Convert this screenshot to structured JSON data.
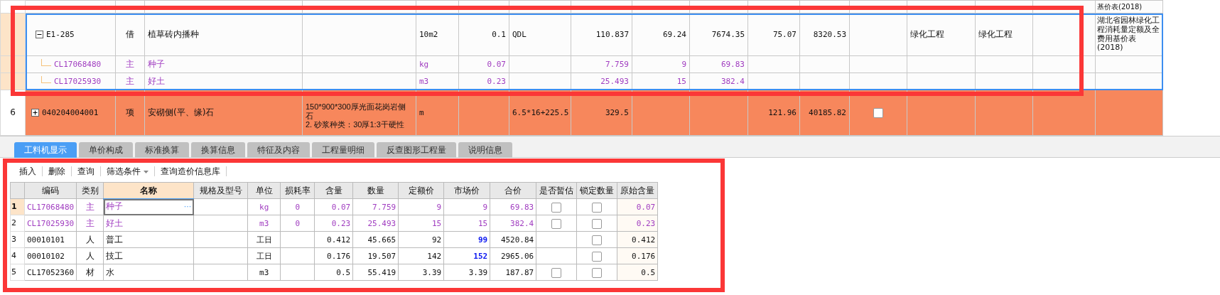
{
  "top_grid": {
    "rows": [
      {
        "kind": "partial",
        "selected": false,
        "highlighted": false,
        "column_17": "基价表(2018)"
      },
      {
        "kind": "quota",
        "selected": true,
        "highlighted": false,
        "expanded": true,
        "column_1": "E1-285",
        "column_2": "借",
        "column_3": "植草砖内播种",
        "column_5": "10m2",
        "column_6": "0.1",
        "column_7": "QDL",
        "column_8": "110.837",
        "column_9": "69.24",
        "column_10": "7674.35",
        "column_11": "75.07",
        "column_12": "8320.53",
        "column_14": "绿化工程",
        "column_15": "绿化工程",
        "column_17": "湖北省园林绿化工程消耗量定额及全费用基价表(2018)"
      },
      {
        "kind": "material",
        "selected": true,
        "highlighted": false,
        "column_1": "CL17068480",
        "column_2": "主",
        "column_3": "种子",
        "column_5": "kg",
        "column_6": "0.07",
        "column_8": "7.759",
        "column_9": "9",
        "column_10": "69.83"
      },
      {
        "kind": "material",
        "selected": true,
        "highlighted": false,
        "column_1": "CL17025930",
        "column_2": "主",
        "column_3": "好土",
        "column_5": "m3",
        "column_6": "0.23",
        "column_8": "25.493",
        "column_9": "15",
        "column_10": "382.4"
      },
      {
        "kind": "item",
        "selected": false,
        "highlighted": true,
        "expanded": false,
        "row_number": "6",
        "column_1": "040204004001",
        "column_2": "项",
        "column_3": "安砌侧(平、缘)石",
        "column_4": [
          "150*900*300厚光面花岗岩侧石",
          "2. 砂浆种类：30厚1:3干硬性"
        ],
        "column_5": "m",
        "column_7": "6.5*16+225.5",
        "column_8": "329.5",
        "column_11": "121.96",
        "column_12": "40185.82",
        "column_13_checked": false
      }
    ]
  },
  "tabs": [
    {
      "label": "工料机显示",
      "selected": true
    },
    {
      "label": "单价构成",
      "selected": false
    },
    {
      "label": "标准换算",
      "selected": false
    },
    {
      "label": "换算信息",
      "selected": false
    },
    {
      "label": "特征及内容",
      "selected": false
    },
    {
      "label": "工程量明细",
      "selected": false
    },
    {
      "label": "反查图形工程量",
      "selected": false
    },
    {
      "label": "说明信息",
      "selected": false
    }
  ],
  "toolbar": [
    {
      "label": "插入",
      "dropdown": false
    },
    {
      "label": "删除",
      "dropdown": false
    },
    {
      "label": "查询",
      "dropdown": false
    },
    {
      "label": "筛选条件",
      "dropdown": true
    },
    {
      "label": "查询造价信息库",
      "dropdown": false
    }
  ],
  "resource_table": {
    "columns": [
      {
        "label": "编码",
        "selected": false
      },
      {
        "label": "类别",
        "selected": false
      },
      {
        "label": "名称",
        "selected": true
      },
      {
        "label": "规格及型号",
        "selected": false
      },
      {
        "label": "单位",
        "selected": false
      },
      {
        "label": "损耗率",
        "selected": false
      },
      {
        "label": "含量",
        "selected": false
      },
      {
        "label": "数量",
        "selected": false
      },
      {
        "label": "定额价",
        "selected": false
      },
      {
        "label": "市场价",
        "selected": false
      },
      {
        "label": "合价",
        "selected": false
      },
      {
        "label": "是否暂估",
        "selected": false
      },
      {
        "label": "锁定数量",
        "selected": false
      },
      {
        "label": "原始含量",
        "selected": false
      }
    ],
    "rows": [
      {
        "row_number": "1",
        "kind": "material",
        "selected": true,
        "code": "CL17068480",
        "type": "主",
        "name": "种子",
        "edit_button": "···",
        "unit": "kg",
        "loss_rate": "0",
        "content": "0.07",
        "quantity": "7.759",
        "quota_price": "9",
        "market_price": "9",
        "market_price_changed": false,
        "total": "69.83",
        "provisional": false,
        "locked": false,
        "original_content": "0.07"
      },
      {
        "row_number": "2",
        "kind": "material",
        "selected": false,
        "code": "CL17025930",
        "type": "主",
        "name": "好土",
        "unit": "m3",
        "loss_rate": "0",
        "content": "0.23",
        "quantity": "25.493",
        "quota_price": "15",
        "market_price": "15",
        "market_price_changed": false,
        "total": "382.4",
        "provisional": false,
        "locked": false,
        "original_content": "0.23"
      },
      {
        "row_number": "3",
        "kind": "labor",
        "selected": false,
        "code": "00010101",
        "type": "人",
        "name": "普工",
        "unit": "工日",
        "content": "0.412",
        "quantity": "45.665",
        "quota_price": "92",
        "market_price": "99",
        "market_price_changed": true,
        "total": "4520.84",
        "locked": false,
        "original_content": "0.412"
      },
      {
        "row_number": "4",
        "kind": "labor",
        "selected": false,
        "code": "00010102",
        "type": "人",
        "name": "技工",
        "unit": "工日",
        "content": "0.176",
        "quantity": "19.507",
        "quota_price": "142",
        "market_price": "152",
        "market_price_changed": true,
        "total": "2965.06",
        "locked": false,
        "original_content": "0.176"
      },
      {
        "row_number": "5",
        "kind": "other",
        "selected": false,
        "code": "CL17052360",
        "type": "材",
        "name": "水",
        "unit": "m3",
        "content": "0.5",
        "quantity": "55.419",
        "quota_price": "3.39",
        "market_price": "3.39",
        "market_price_changed": false,
        "total": "187.87",
        "provisional": false,
        "locked": false,
        "original_content": "0.5"
      }
    ]
  }
}
